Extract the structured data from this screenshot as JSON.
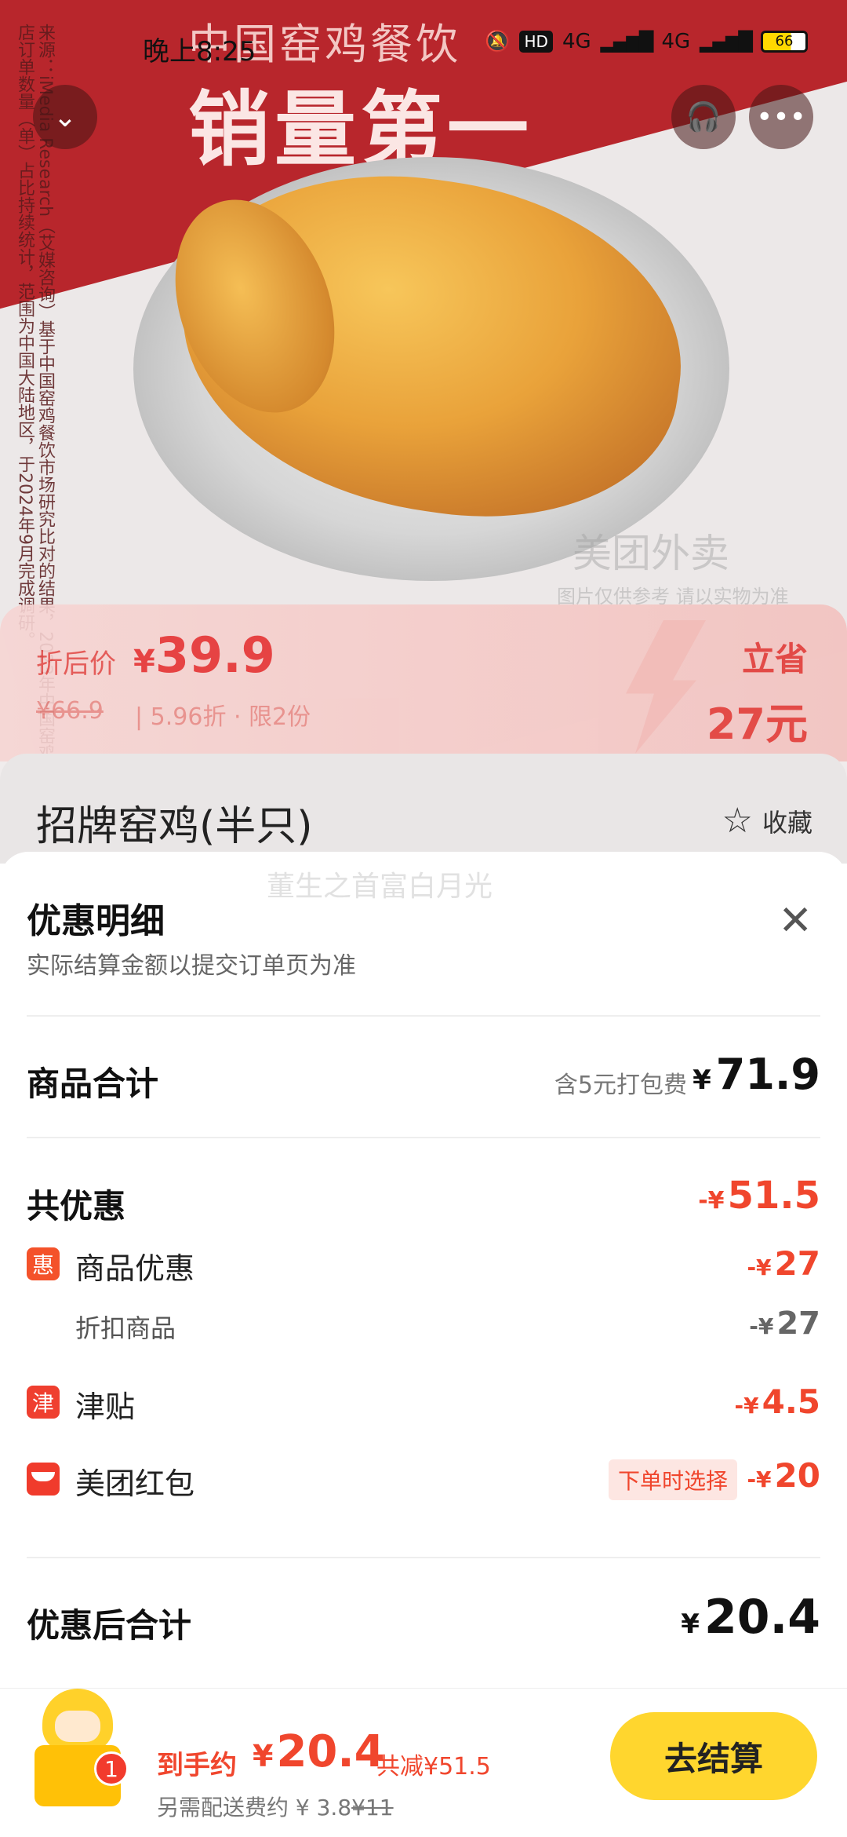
{
  "status_bar": {
    "time": "晚上8:25",
    "network1": "4G",
    "network2": "4G",
    "hd": "HD",
    "battery": "66"
  },
  "hero": {
    "title_line1": "中国窑鸡餐饮",
    "title_line2": "销量第一",
    "side_note": "来源：iMedia Research（艾媒咨询）基于中国窑鸡餐饮市场研究比对的结果，2023年中国窑鸡餐饮品牌门店订单数量（单）占比持续统计，范围为中国大陆地区，于2024年9月完成调研。",
    "watermark_brand": "美团外卖",
    "watermark_note": "图片仅供参考 请以实物为准"
  },
  "price": {
    "label": "折后价",
    "yen": "¥",
    "now": "39.9",
    "original": "¥66.9",
    "info": "5.96折 · 限2份",
    "save_label": "立省",
    "save_amount": "27元"
  },
  "product": {
    "title": "招牌窑鸡(半只)",
    "fav_label": "收藏"
  },
  "sheet": {
    "watermark": "董生之首富白月光",
    "title": "优惠明细",
    "subtitle": "实际结算金额以提交订单页为准",
    "subtotal_label": "商品合计",
    "subtotal_hint": "含5元打包费",
    "subtotal_amount": "71.9",
    "discount_label": "共优惠",
    "discount_amount": "51.5",
    "items": [
      {
        "tag": "惠",
        "label": "商品优惠",
        "amount": "27"
      },
      {
        "label": "折扣商品",
        "amount": "27"
      },
      {
        "tag": "津",
        "label": "津贴",
        "amount": "4.5"
      },
      {
        "label": "美团红包",
        "badge": "下单时选择",
        "amount": "20"
      }
    ],
    "final_label": "优惠后合计",
    "final_amount": "20.4",
    "yen": "¥",
    "minus_yen": "-¥"
  },
  "bottom": {
    "badge": "1",
    "pay_label": "到手约",
    "pay_amount": "20.4",
    "total_saving": "共减¥51.5",
    "delivery_text": "另需配送费约 ¥ 3.8",
    "delivery_original": "¥11",
    "checkout_label": "去结算"
  },
  "colors": {
    "accent_red": "#f0462d",
    "hero_red": "#b8262c",
    "checkout_yellow": "#ffd62e"
  }
}
